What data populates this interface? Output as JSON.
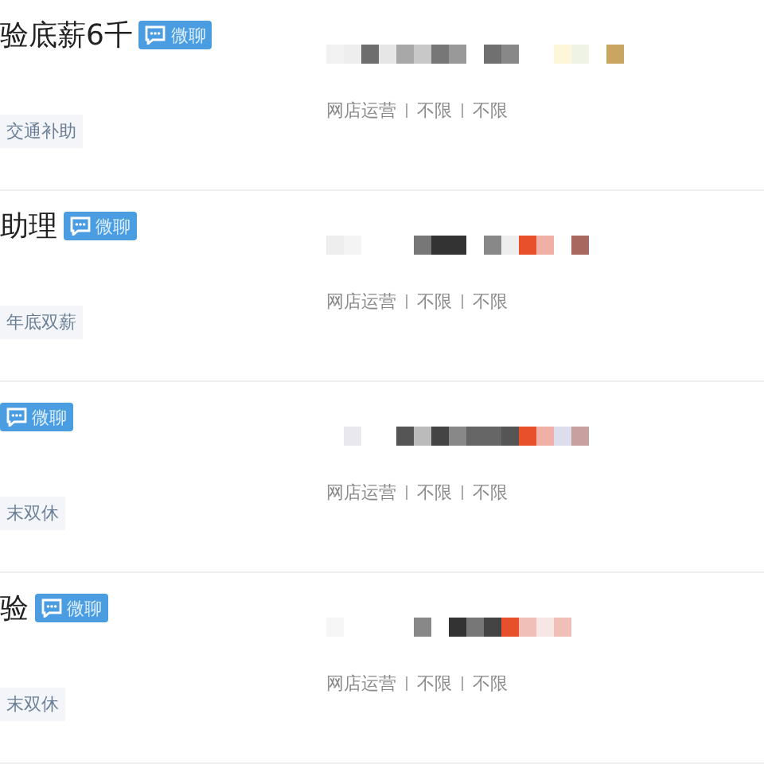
{
  "jobs": [
    {
      "title": "验底薪6千",
      "chat_badge": "微聊",
      "tags": [
        "交通补助"
      ],
      "meta": [
        "网店运营",
        "不限",
        "不限"
      ]
    },
    {
      "title": "助理",
      "chat_badge": "微聊",
      "tags": [
        "年底双薪"
      ],
      "meta": [
        "网店运营",
        "不限",
        "不限"
      ]
    },
    {
      "chat_badge": "微聊",
      "tags": [
        "末双休"
      ],
      "meta": [
        "网店运营",
        "不限",
        "不限"
      ]
    },
    {
      "title": "验",
      "chat_badge": "微聊",
      "tags": [
        "末双休"
      ],
      "meta": [
        "网店运营",
        "不限",
        "不限"
      ]
    }
  ]
}
